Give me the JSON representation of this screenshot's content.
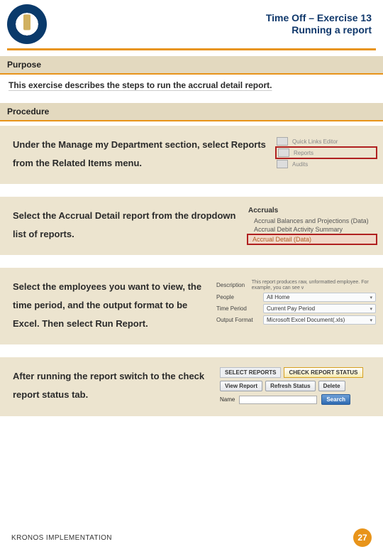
{
  "header": {
    "title_line1": "Time Off – Exercise 13",
    "title_line2": "Running a report"
  },
  "purpose": {
    "label": "Purpose",
    "text": "This exercise describes the steps to run the accrual detail report."
  },
  "procedure": {
    "label": "Procedure"
  },
  "steps": {
    "s1": {
      "text_a": "Under the Manage my Department section, select ",
      "bold": "Reports",
      "text_b": " from the Related Items menu.",
      "fig": {
        "row1": "Quick Links Editor",
        "row2": "Reports",
        "row3": "Audits"
      }
    },
    "s2": {
      "text": "Select the Accrual Detail report from the dropdown list of reports.",
      "fig": {
        "title": "Accruals",
        "i1": "Accrual Balances and Projections (Data)",
        "i2": "Accrual Debit Activity Summary",
        "i3": "Accrual Detail (Data)"
      }
    },
    "s3": {
      "text_a": "Select the employees you want to view, the time period, and the output format to be Excel. Then select ",
      "bold": "Run Report",
      "text_b": ".",
      "fig": {
        "desc_l": "Description",
        "desc_v": "This report produces raw, unformatted employee. For example, you can see v",
        "people_l": "People",
        "people_v": "All Home",
        "tp_l": "Time Period",
        "tp_v": "Current Pay Period",
        "fmt_l": "Output Format",
        "fmt_v": "Microsoft Excel Document(.xls)"
      }
    },
    "s4": {
      "text": "After running the report switch to the check report status tab.",
      "fig": {
        "tab1": "SELECT REPORTS",
        "tab2": "CHECK REPORT STATUS",
        "btn1": "View Report",
        "btn2": "Refresh Status",
        "btn3": "Delete",
        "name_l": "Name",
        "search": "Search"
      }
    }
  },
  "footer": {
    "text": "KRONOS IMPLEMENTATION",
    "page": "27"
  }
}
